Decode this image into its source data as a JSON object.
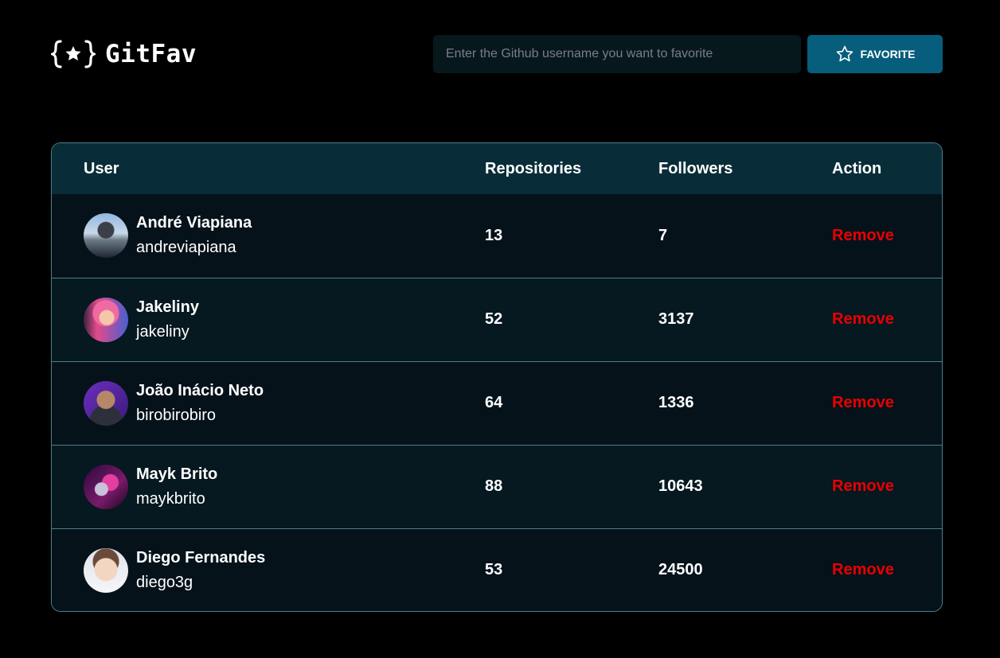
{
  "app": {
    "title": "GitFav",
    "logo_icon": "braces-star-icon"
  },
  "search": {
    "placeholder": "Enter the Github username you want to favorite",
    "value": "",
    "button_label": "FAVORITE",
    "button_icon": "star-outline-icon"
  },
  "colors": {
    "background": "#000000",
    "accent": "#065E7C",
    "table_header": "#092D38",
    "border": "#4A808C",
    "remove": "#E80000"
  },
  "table": {
    "headers": {
      "user": "User",
      "repositories": "Repositories",
      "followers": "Followers",
      "action": "Action"
    },
    "rows": [
      {
        "name": "André Viapiana",
        "login": "andreviapiana",
        "repositories": "13",
        "followers": "7",
        "action": "Remove"
      },
      {
        "name": "Jakeliny",
        "login": "jakeliny",
        "repositories": "52",
        "followers": "3137",
        "action": "Remove"
      },
      {
        "name": "João Inácio Neto",
        "login": "birobirobiro",
        "repositories": "64",
        "followers": "1336",
        "action": "Remove"
      },
      {
        "name": "Mayk Brito",
        "login": "maykbrito",
        "repositories": "88",
        "followers": "10643",
        "action": "Remove"
      },
      {
        "name": "Diego Fernandes",
        "login": "diego3g",
        "repositories": "53",
        "followers": "24500",
        "action": "Remove"
      }
    ]
  }
}
